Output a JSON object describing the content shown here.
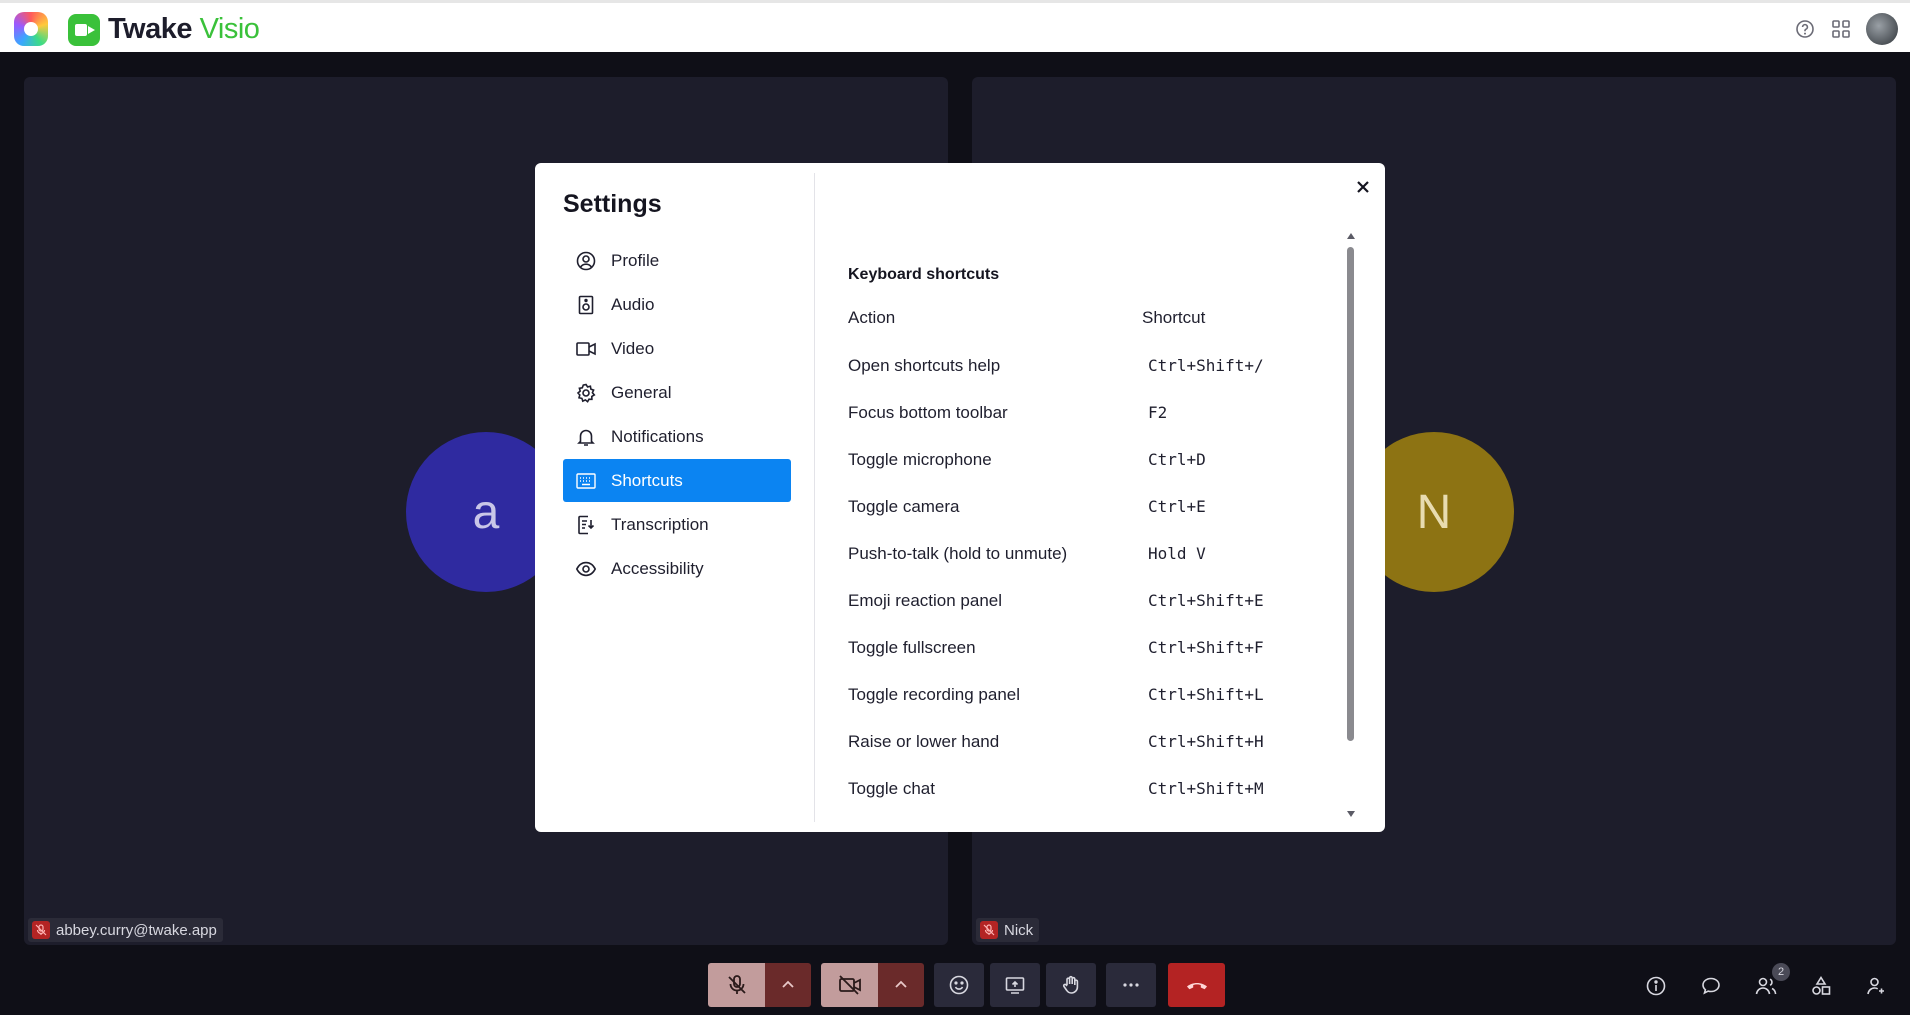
{
  "header": {
    "brand_main": "Twake",
    "brand_accent": "Visio",
    "icons": [
      "help-icon",
      "apps-grid-icon",
      "user-avatar"
    ]
  },
  "participants": [
    {
      "initial": "a",
      "name": "abbey.curry@twake.app",
      "color": "#2f2aa0",
      "muted": true
    },
    {
      "initial": "N",
      "name": "Nick",
      "color": "#8d7313",
      "muted": true
    }
  ],
  "settings": {
    "title": "Settings",
    "menu": [
      {
        "label": "Profile",
        "icon": "profile-icon",
        "active": false
      },
      {
        "label": "Audio",
        "icon": "speaker-icon",
        "active": false
      },
      {
        "label": "Video",
        "icon": "video-icon",
        "active": false
      },
      {
        "label": "General",
        "icon": "gear-icon",
        "active": false
      },
      {
        "label": "Notifications",
        "icon": "bell-icon",
        "active": false
      },
      {
        "label": "Shortcuts",
        "icon": "keyboard-icon",
        "active": true
      },
      {
        "label": "Transcription",
        "icon": "transcription-icon",
        "active": false
      },
      {
        "label": "Accessibility",
        "icon": "eye-icon",
        "active": false
      }
    ],
    "shortcuts": {
      "section_title": "Keyboard shortcuts",
      "col_action": "Action",
      "col_shortcut": "Shortcut",
      "rows": [
        {
          "action": "Open shortcuts help",
          "key": "Ctrl+Shift+/"
        },
        {
          "action": "Focus bottom toolbar",
          "key": "F2"
        },
        {
          "action": "Toggle microphone",
          "key": "Ctrl+D"
        },
        {
          "action": "Toggle camera",
          "key": "Ctrl+E"
        },
        {
          "action": "Push-to-talk (hold to unmute)",
          "key": "Hold V"
        },
        {
          "action": "Emoji reaction panel",
          "key": "Ctrl+Shift+E"
        },
        {
          "action": "Toggle fullscreen",
          "key": "Ctrl+Shift+F"
        },
        {
          "action": "Toggle recording panel",
          "key": "Ctrl+Shift+L"
        },
        {
          "action": "Raise or lower hand",
          "key": "Ctrl+Shift+H"
        },
        {
          "action": "Toggle chat",
          "key": "Ctrl+Shift+M"
        }
      ]
    }
  },
  "toolbar": {
    "participants_count": "2"
  },
  "colors": {
    "accent": "#0b84f2",
    "brand_green": "#3ac13a",
    "danger": "#b42323",
    "tile_bg": "#1d1d2b"
  }
}
